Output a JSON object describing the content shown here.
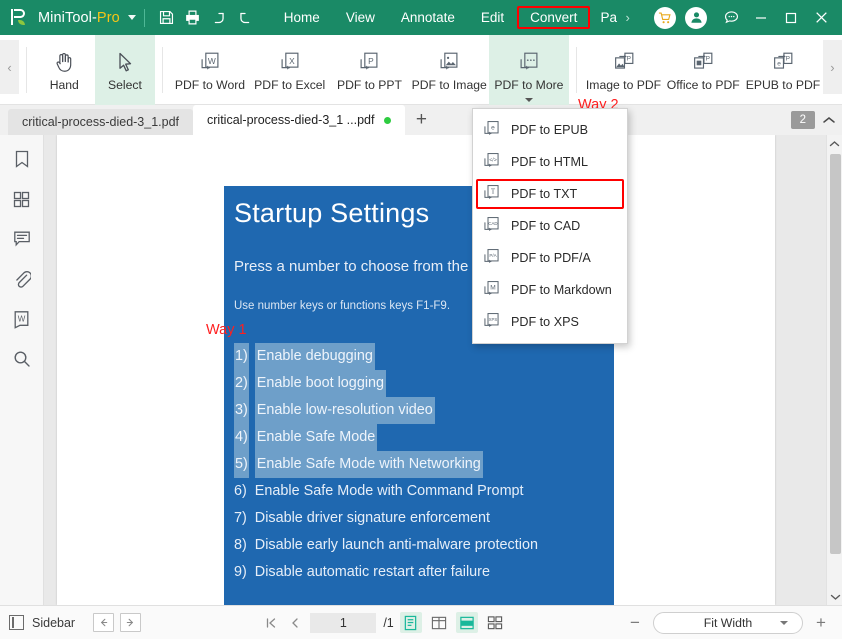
{
  "titlebar": {
    "app_name_main": "MiniTool-",
    "app_name_suffix": "Pro",
    "logo_icon": "minitool-pdf-logo",
    "dropdown_caret_icon": "caret-down-icon",
    "quick_actions": [
      {
        "name": "save-button",
        "icon": "save-floppy-icon"
      },
      {
        "name": "print-button",
        "icon": "printer-icon"
      },
      {
        "name": "undo-button",
        "icon": "undo-arrow-icon"
      },
      {
        "name": "redo-button",
        "icon": "redo-arrow-icon"
      }
    ],
    "menus": [
      {
        "label": "Home",
        "highlighted": false
      },
      {
        "label": "View",
        "highlighted": false
      },
      {
        "label": "Annotate",
        "highlighted": false
      },
      {
        "label": "Edit",
        "highlighted": false
      },
      {
        "label": "Convert",
        "highlighted": true
      },
      {
        "label": "Pa",
        "highlighted": false,
        "clipped": true
      }
    ],
    "menu_overflow_icon": "chevron-right-icon",
    "cart_icon": "shopping-cart-icon",
    "account_icon": "user-account-icon",
    "feedback_icon": "chat-bubble-icon",
    "minimize_icon": "minimize-icon",
    "maximize_icon": "maximize-icon",
    "close_icon": "close-icon",
    "highlight_color": "#ff0000",
    "bar_color": "#1a8a66"
  },
  "ribbon": {
    "scroll_left_icon": "chevron-left-icon",
    "scroll_right_icon": "chevron-right-icon",
    "tools": [
      {
        "label": "Hand",
        "icon": "hand-icon",
        "selected": false,
        "has_dropdown": false
      },
      {
        "label": "Select",
        "icon": "cursor-arrow-icon",
        "selected": true,
        "has_dropdown": false
      },
      {
        "label": "PDF to Word",
        "icon": "pdf-to-word-icon",
        "selected": false,
        "has_dropdown": false
      },
      {
        "label": "PDF to Excel",
        "icon": "pdf-to-excel-icon",
        "selected": false,
        "has_dropdown": false
      },
      {
        "label": "PDF to PPT",
        "icon": "pdf-to-ppt-icon",
        "selected": false,
        "has_dropdown": false
      },
      {
        "label": "PDF to Image",
        "icon": "pdf-to-image-icon",
        "selected": false,
        "has_dropdown": false
      },
      {
        "label": "PDF to More",
        "icon": "pdf-to-more-icon",
        "selected": true,
        "has_dropdown": true
      },
      {
        "label": "Image to PDF",
        "icon": "image-to-pdf-icon",
        "selected": false,
        "has_dropdown": false
      },
      {
        "label": "Office to PDF",
        "icon": "office-to-pdf-icon",
        "selected": false,
        "has_dropdown": false
      },
      {
        "label": "EPUB to PDF",
        "icon": "epub-to-pdf-icon",
        "selected": false,
        "has_dropdown": false
      }
    ]
  },
  "tabstrip": {
    "tabs": [
      {
        "label": "critical-process-died-3_1.pdf",
        "active": false,
        "modified": false
      },
      {
        "label": "critical-process-died-3_1 ...pdf",
        "active": true,
        "modified": true
      }
    ],
    "add_tab_icon": "plus-icon",
    "tab_count_badge": "2",
    "collapse_icon": "chevron-up-icon"
  },
  "left_rail": [
    {
      "name": "sidebar-bookmark",
      "icon": "bookmark-icon"
    },
    {
      "name": "sidebar-thumbnails",
      "icon": "grid-thumbnails-icon"
    },
    {
      "name": "sidebar-comments",
      "icon": "comment-bubble-icon"
    },
    {
      "name": "sidebar-attachments",
      "icon": "paperclip-icon"
    },
    {
      "name": "sidebar-stamp",
      "icon": "word-document-icon"
    },
    {
      "name": "sidebar-search",
      "icon": "magnifier-search-icon"
    }
  ],
  "dropdown": {
    "items": [
      {
        "label": "PDF to EPUB",
        "icon": "pdf-to-epub-icon",
        "glyph": "e",
        "highlighted": false
      },
      {
        "label": "PDF to HTML",
        "icon": "pdf-to-html-icon",
        "glyph": "</>",
        "highlighted": false
      },
      {
        "label": "PDF to TXT",
        "icon": "pdf-to-txt-icon",
        "glyph": "T",
        "highlighted": true
      },
      {
        "label": "PDF to CAD",
        "icon": "pdf-to-cad-icon",
        "glyph": "CAD",
        "highlighted": false
      },
      {
        "label": "PDF to PDF/A",
        "icon": "pdf-to-pdfa-icon",
        "glyph": "P/A",
        "highlighted": false
      },
      {
        "label": "PDF to Markdown",
        "icon": "pdf-to-markdown-icon",
        "glyph": "M",
        "highlighted": false
      },
      {
        "label": "PDF to XPS",
        "icon": "pdf-to-xps-icon",
        "glyph": "XPS",
        "highlighted": false
      }
    ]
  },
  "annotations": [
    {
      "id": "way-1",
      "text": "Way 1",
      "color": "#ff1f1f"
    },
    {
      "id": "way-2",
      "text": "Way 2",
      "color": "#ff1f1f"
    }
  ],
  "document": {
    "slide_bg": "#1f68b0",
    "title": "Startup Settings",
    "subtitle": "Press a number to choose from the options below:",
    "note": "Use number keys or functions keys F1-F9.",
    "options": [
      {
        "num": "1)",
        "text": "Enable debugging",
        "selected": true
      },
      {
        "num": "2)",
        "text": "Enable boot logging",
        "selected": true
      },
      {
        "num": "3)",
        "text": "Enable low-resolution video",
        "selected": true
      },
      {
        "num": "4)",
        "text": "Enable Safe Mode",
        "selected": true
      },
      {
        "num": "5)",
        "text": "Enable Safe Mode with Networking",
        "selected": true
      },
      {
        "num": "6)",
        "text": "Enable Safe Mode with Command Prompt",
        "selected": false
      },
      {
        "num": "7)",
        "text": "Disable driver signature enforcement",
        "selected": false
      },
      {
        "num": "8)",
        "text": "Disable early launch anti-malware protection",
        "selected": false
      },
      {
        "num": "9)",
        "text": "Disable automatic restart after failure",
        "selected": false
      }
    ]
  },
  "statusbar": {
    "sidebar_label": "Sidebar",
    "sidebar_toggle_icon": "sidebar-panel-icon",
    "prev_arrow_icon": "arrow-left-icon",
    "next_arrow_icon": "arrow-right-icon",
    "first_page_icon": "first-page-icon",
    "prev_page_icon": "prev-page-icon",
    "page_number": "1",
    "page_total": "/1",
    "view_modes": [
      {
        "name": "single-page-view",
        "icon": "single-page-icon",
        "active": true
      },
      {
        "name": "two-page-view",
        "icon": "two-page-icon",
        "active": false
      },
      {
        "name": "continuous-scroll-view",
        "icon": "continuous-scroll-icon",
        "active": true
      },
      {
        "name": "grid-page-view",
        "icon": "grid-page-icon",
        "active": false
      }
    ],
    "zoom_out_label": "−",
    "zoom_level_label": "Fit Width",
    "zoom_dropdown_icon": "caret-down-icon",
    "zoom_in_label": "+"
  },
  "scrollbar": {
    "up_arrow_icon": "chevron-up-icon",
    "down_arrow_icon": "chevron-down-icon"
  }
}
